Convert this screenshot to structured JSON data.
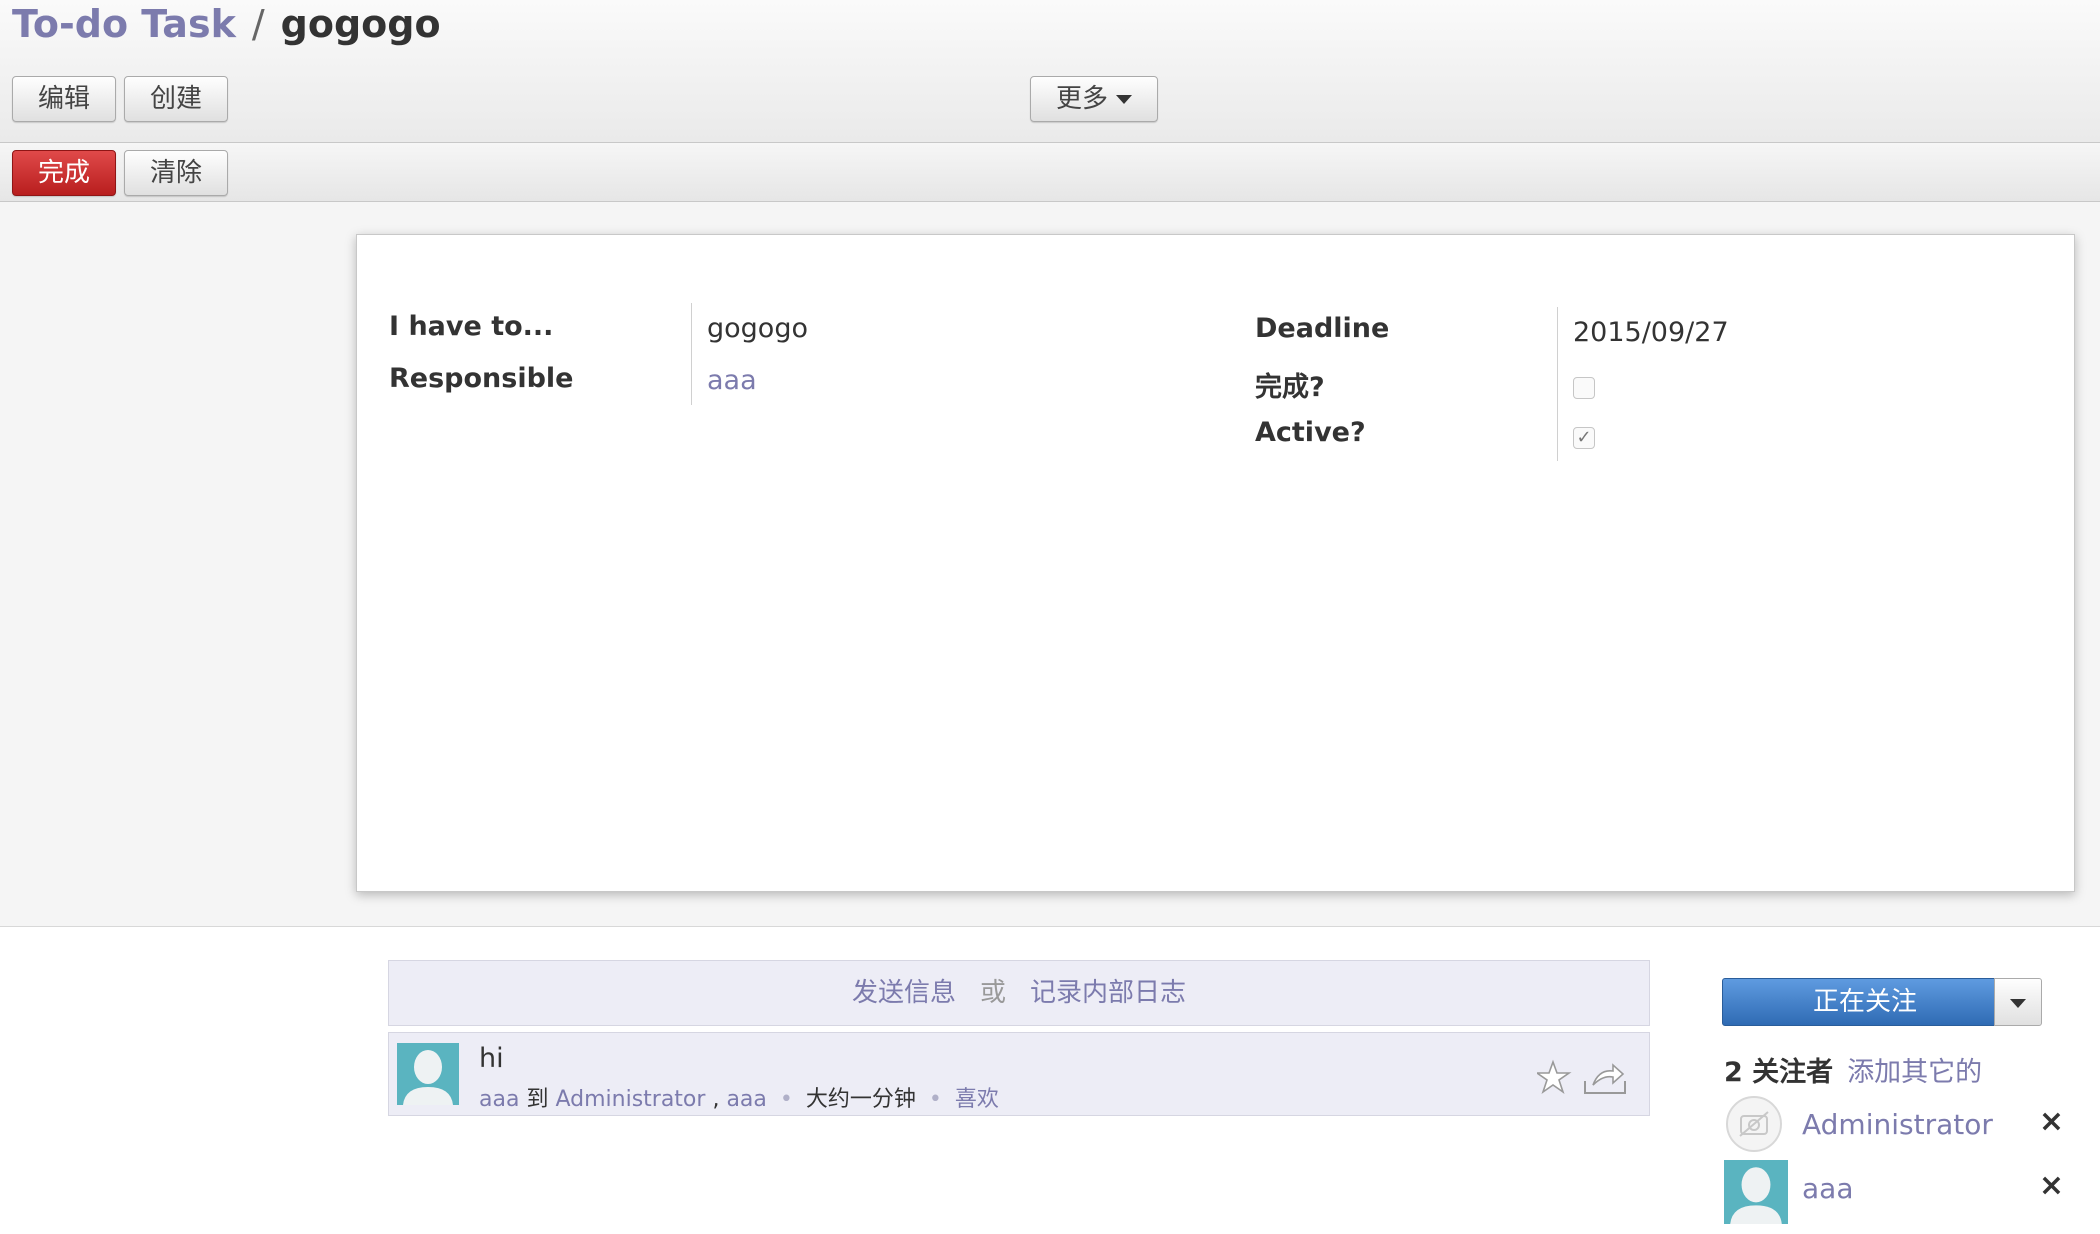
{
  "breadcrumb": {
    "parent": "To-do Task",
    "separator": "/",
    "current": "gogogo"
  },
  "toolbar": {
    "edit": "编辑",
    "create": "创建",
    "more": "更多"
  },
  "statusbar": {
    "done": "完成",
    "clear": "清除"
  },
  "form": {
    "fields_left": [
      {
        "label": "I have to...",
        "value": "gogogo"
      },
      {
        "label": "Responsible",
        "value": "aaa"
      }
    ],
    "fields_right": [
      {
        "label": "Deadline",
        "value": "2015/09/27"
      },
      {
        "label": "完成?",
        "checked": false
      },
      {
        "label": "Active?",
        "checked": true
      }
    ]
  },
  "chatter": {
    "send_message": "发送信息",
    "or": "或",
    "log_note": "记录内部日志",
    "messages": [
      {
        "body": "hi",
        "author": "aaa",
        "to": "到",
        "recipient1": "Administrator",
        "comma": ",",
        "recipient2": "aaa",
        "time": "大约一分钟",
        "like": "喜欢"
      }
    ]
  },
  "followers": {
    "follow_button": "正在关注",
    "count": "2 关注者",
    "add_others": "添加其它的",
    "list": [
      {
        "name": "Administrator",
        "remove": "×"
      },
      {
        "name": "aaa",
        "remove": "×"
      }
    ]
  },
  "colors": {
    "link": "#7c7bad",
    "primary": "#c0262a",
    "follow": "#3f7cc4",
    "avatar": "#5ab4c0"
  }
}
